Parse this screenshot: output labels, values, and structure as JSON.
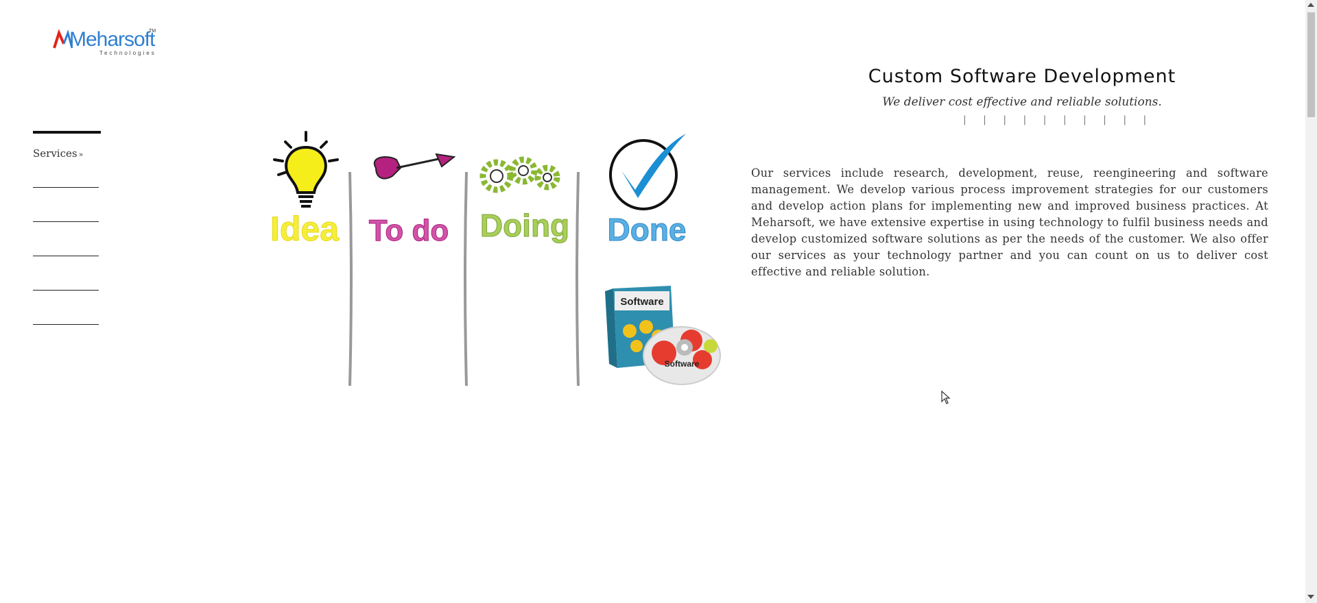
{
  "logo": {
    "brand": "Meharsoft",
    "trademark": "TM",
    "tagline": "Technologies"
  },
  "nav": {
    "services_label": "Services",
    "services_icon": "double-chevron-down-icon"
  },
  "hero": {
    "title": "Custom Software Development",
    "subtitle": "We deliver cost effective and reliable solutions.",
    "dividers": "| | | | | | | | | |",
    "description": "Our services include research, development, reuse, reengineering and software management. We develop various process improvement strategies for our customers and develop action plans for implementing new and improved business practices. At Meharsoft, we have extensive expertise in using technology to fulfil business needs and develop customized software solutions as per the needs of the customer. We also offer our services as your technology partner and you can count on us to deliver cost effective and reliable solution."
  },
  "illustration": {
    "columns": [
      "Idea",
      "To do",
      "Doing",
      "Done"
    ],
    "box_label": "Software",
    "disc_label": "Software"
  },
  "colors": {
    "idea": "#f5ee3a",
    "todo": "#c2258f",
    "doing": "#9bc53d",
    "done": "#2e9bd6",
    "logo_blue": "#2f7fd0",
    "logo_red": "#e2231a"
  }
}
